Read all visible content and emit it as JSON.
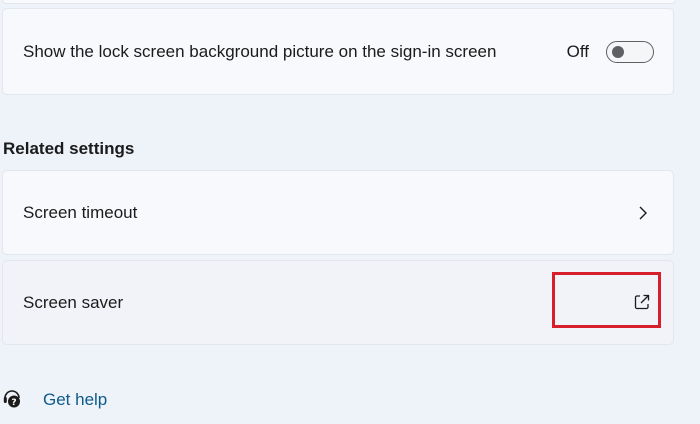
{
  "lock_screen_setting": {
    "label": "Show the lock screen background picture on the sign-in screen",
    "state": "Off",
    "enabled": false
  },
  "related_settings": {
    "heading": "Related settings",
    "items": [
      {
        "label": "Screen timeout",
        "icon": "chevron-right-icon"
      },
      {
        "label": "Screen saver",
        "icon": "open-external-icon"
      }
    ]
  },
  "help": {
    "label": "Get help",
    "icon": "help-headset-icon"
  },
  "colors": {
    "background": "#eef2f9",
    "card": "#f7f9fc",
    "link": "#0e5a8a",
    "highlight": "#d61f2b"
  }
}
